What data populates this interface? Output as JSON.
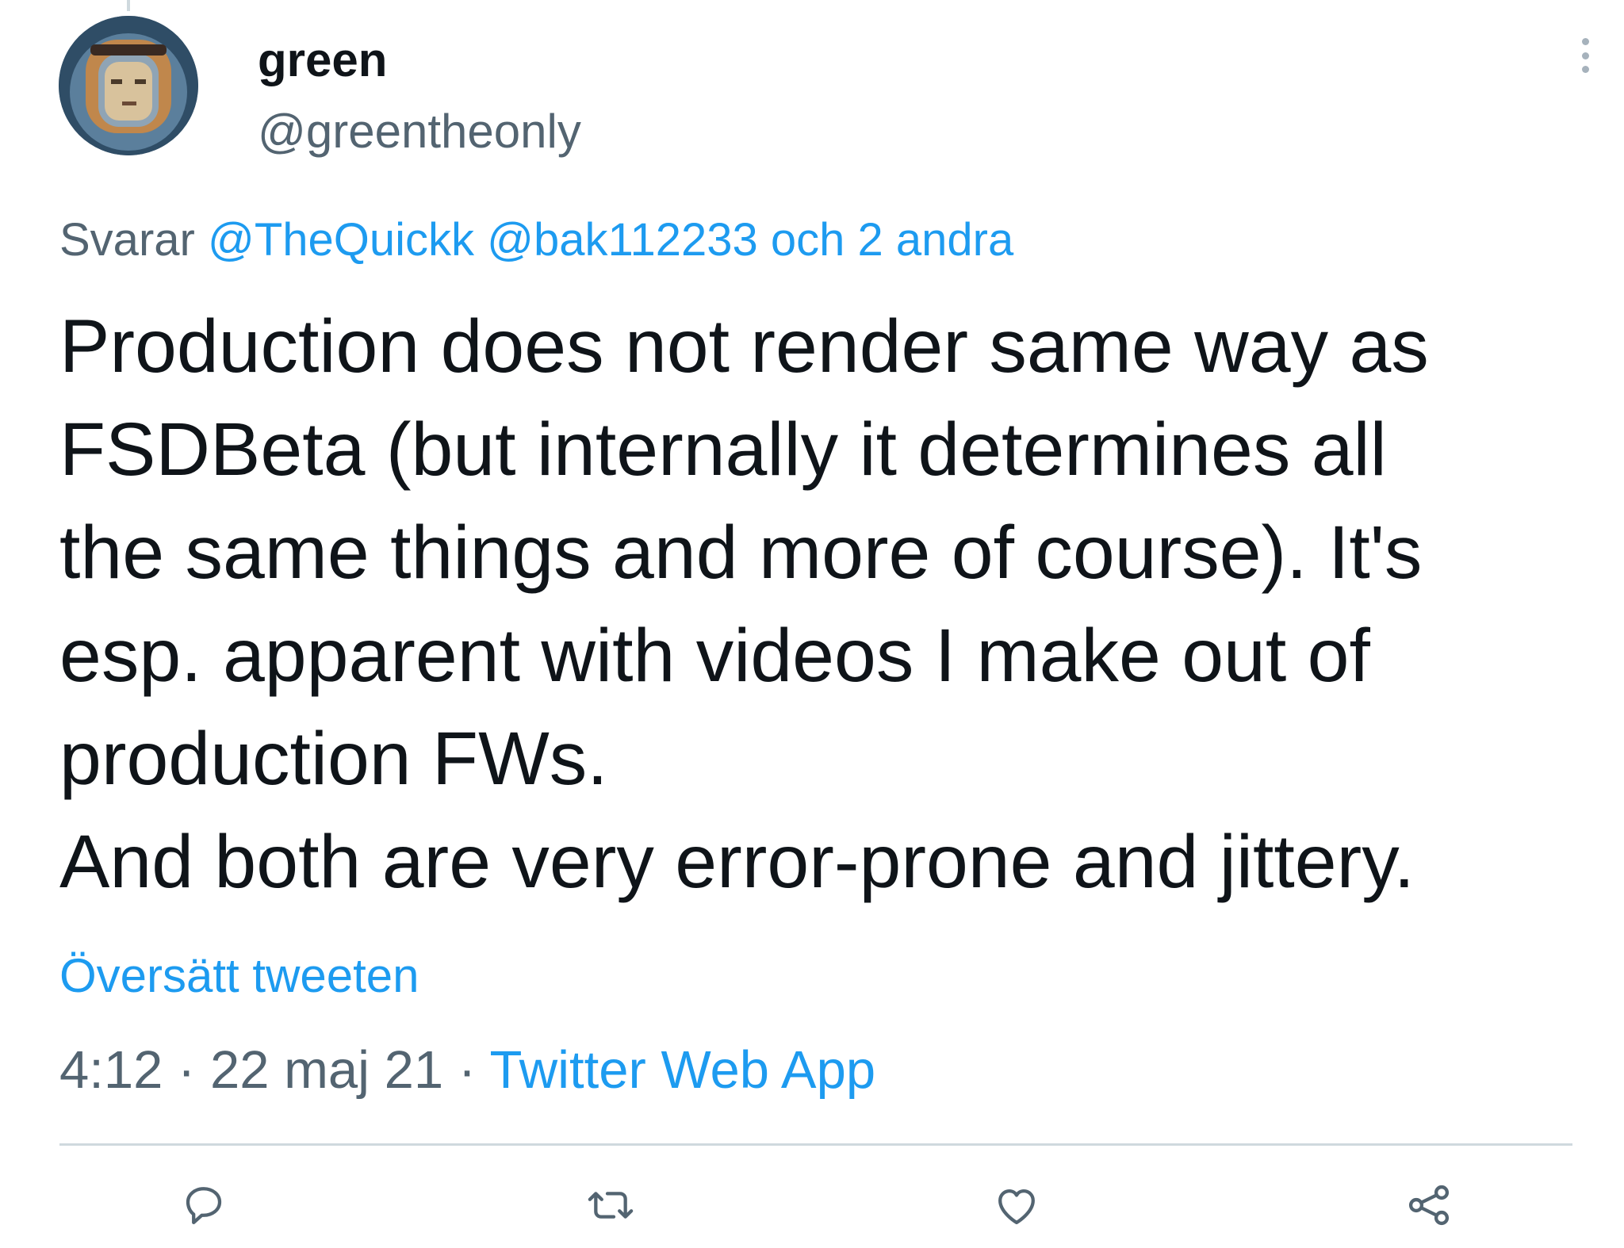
{
  "tweet": {
    "author": {
      "name": "green",
      "handle": "@greentheonly"
    },
    "reply": {
      "prefix": "Svarar",
      "mentions": "@TheQuickk @bak112233 och 2 andra"
    },
    "text": "Production does not render same way as\nFSDBeta (but internally it determines all\nthe same things and more of course). It's\nesp. apparent with videos I make out of\nproduction FWs.\nAnd both are very error-prone and jittery.",
    "translate_label": "Översätt tweeten",
    "time": "4:12",
    "separator_1": " · ",
    "date": "22 maj 21",
    "separator_2": " · ",
    "source": "Twitter Web App"
  },
  "actions": {
    "reply_icon": "comment-icon",
    "retweet_icon": "retweet-icon",
    "like_icon": "heart-icon",
    "share_icon": "share-icon"
  },
  "colors": {
    "accent": "#1d9bf0",
    "secondary_text": "#536471",
    "primary_text": "#0f1419",
    "icon": "#536471",
    "divider": "#cfd9de"
  }
}
